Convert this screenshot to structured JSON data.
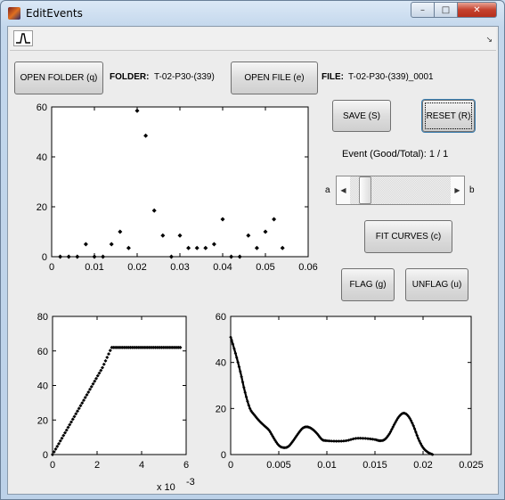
{
  "window": {
    "title": "EditEvents"
  },
  "toolbar": {
    "plot_tool_icon": "plot-waveform-icon",
    "overflow_icon": "chevron-icon"
  },
  "controls": {
    "open_folder_label": "OPEN FOLDER (q)",
    "folder_caption": "FOLDER:",
    "folder_value": "T-02-P30-(339)",
    "open_file_label": "OPEN FILE (e)",
    "file_caption": "FILE:",
    "file_value": "T-02-P30-(339)_0001",
    "save_label": "SAVE (S)",
    "reset_label": "RESET (R)",
    "event_status": "Event (Good/Total): 1 / 1",
    "slider_left": "a",
    "slider_right": "b",
    "slider_position": 0.1,
    "fit_curves_label": "FIT CURVES (c)",
    "flag_label": "FLAG (g)",
    "unflag_label": "UNFLAG (u)"
  },
  "chart_data": [
    {
      "type": "scatter",
      "xlim": [
        0,
        0.06
      ],
      "ylim": [
        0,
        60
      ],
      "x_ticks": [
        "0",
        "0.01",
        "0.02",
        "0.03",
        "0.04",
        "0.05",
        "0.06"
      ],
      "y_ticks": [
        "0",
        "20",
        "40",
        "60"
      ],
      "points": [
        [
          0.002,
          0
        ],
        [
          0.004,
          0
        ],
        [
          0.006,
          0
        ],
        [
          0.008,
          5
        ],
        [
          0.01,
          0
        ],
        [
          0.012,
          0
        ],
        [
          0.014,
          5
        ],
        [
          0.016,
          10
        ],
        [
          0.018,
          3.5
        ],
        [
          0.02,
          58.5
        ],
        [
          0.022,
          48.5
        ],
        [
          0.024,
          18.5
        ],
        [
          0.026,
          8.5
        ],
        [
          0.028,
          0
        ],
        [
          0.03,
          8.5
        ],
        [
          0.032,
          3.5
        ],
        [
          0.034,
          3.5
        ],
        [
          0.036,
          3.5
        ],
        [
          0.038,
          5
        ],
        [
          0.04,
          15
        ],
        [
          0.042,
          0
        ],
        [
          0.044,
          0
        ],
        [
          0.046,
          8.5
        ],
        [
          0.048,
          3.5
        ],
        [
          0.05,
          10
        ],
        [
          0.052,
          15
        ],
        [
          0.054,
          3.5
        ]
      ]
    },
    {
      "type": "scatter",
      "xlim": [
        0,
        6
      ],
      "ylim": [
        0,
        80
      ],
      "x_ticks": [
        "0",
        "2",
        "4",
        "6"
      ],
      "y_ticks": [
        "0",
        "20",
        "40",
        "60",
        "80"
      ],
      "x_multiplier": "x 10",
      "x_exponent": "-3",
      "ramp": {
        "x_start": 0,
        "x_end": 2.65,
        "y_start": 0,
        "y_end": 62,
        "x_last": 5.8
      }
    },
    {
      "type": "line",
      "xlim": [
        0,
        0.025
      ],
      "ylim": [
        0,
        60
      ],
      "x_ticks": [
        "0",
        "0.005",
        "0.01",
        "0.015",
        "0.02",
        "0.025"
      ],
      "y_ticks": [
        "0",
        "20",
        "40",
        "60"
      ],
      "control_points": [
        [
          0,
          51
        ],
        [
          0.0005,
          44
        ],
        [
          0.001,
          36
        ],
        [
          0.0015,
          27
        ],
        [
          0.002,
          20
        ],
        [
          0.0025,
          17
        ],
        [
          0.003,
          14.5
        ],
        [
          0.0035,
          12.5
        ],
        [
          0.004,
          10.5
        ],
        [
          0.0045,
          7
        ],
        [
          0.005,
          4
        ],
        [
          0.0055,
          3
        ],
        [
          0.006,
          3.5
        ],
        [
          0.0065,
          6
        ],
        [
          0.007,
          9
        ],
        [
          0.0075,
          11.5
        ],
        [
          0.008,
          12
        ],
        [
          0.0085,
          11
        ],
        [
          0.009,
          9
        ],
        [
          0.0095,
          6.5
        ],
        [
          0.01,
          6
        ],
        [
          0.011,
          5.8
        ],
        [
          0.012,
          6
        ],
        [
          0.013,
          7
        ],
        [
          0.014,
          7
        ],
        [
          0.015,
          6.5
        ],
        [
          0.0155,
          6
        ],
        [
          0.016,
          6.5
        ],
        [
          0.0165,
          9
        ],
        [
          0.017,
          13
        ],
        [
          0.0175,
          16.5
        ],
        [
          0.018,
          18
        ],
        [
          0.0185,
          16.5
        ],
        [
          0.019,
          12.5
        ],
        [
          0.0195,
          7
        ],
        [
          0.02,
          3
        ],
        [
          0.0205,
          1
        ],
        [
          0.021,
          0
        ]
      ]
    }
  ]
}
